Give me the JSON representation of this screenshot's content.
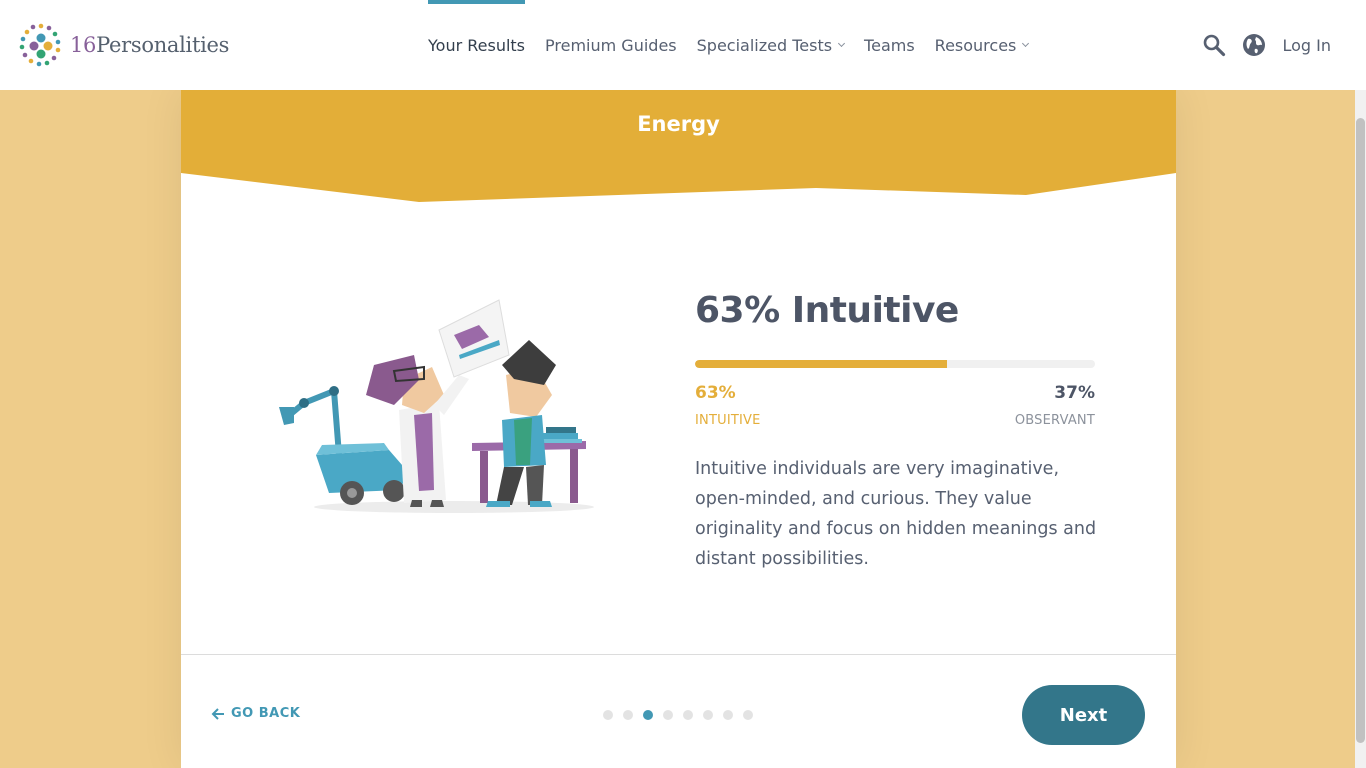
{
  "logo": {
    "num": "16",
    "name": "Personalities"
  },
  "nav": {
    "items": [
      {
        "label": "Your Results",
        "active": true
      },
      {
        "label": "Premium Guides"
      },
      {
        "label": "Specialized Tests",
        "dropdown": true
      },
      {
        "label": "Teams"
      },
      {
        "label": "Resources",
        "dropdown": true
      }
    ],
    "login": "Log In"
  },
  "banner": {
    "title": "Energy",
    "color": "#e3ae38"
  },
  "result": {
    "title": "63% Intuitive",
    "progress": 0.63,
    "left_pct": "63%",
    "right_pct": "37%",
    "left_label": "INTUITIVE",
    "right_label": "OBSERVANT",
    "description": "Intuitive individuals are very imaginative, open-minded, and curious. They value originality and focus on hidden meanings and distant possibilities."
  },
  "footer": {
    "go_back": "GO BACK",
    "dots_total": 8,
    "dots_active": 3,
    "next": "Next"
  },
  "colors": {
    "accent": "#4298b4",
    "yellow": "#e4ae3a",
    "button": "#33768a",
    "background": "#eecc8a"
  }
}
